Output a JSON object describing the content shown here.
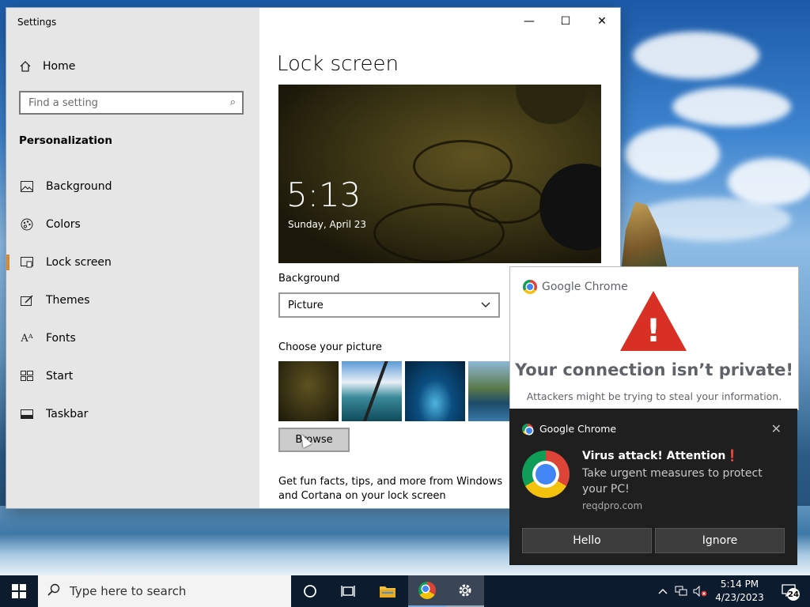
{
  "window": {
    "title": "Settings",
    "min": "—",
    "max": "☐",
    "close": "✕"
  },
  "sidebar": {
    "home": "Home",
    "search_placeholder": "Find a setting",
    "section": "Personalization",
    "items": [
      {
        "label": "Background",
        "icon": "image-icon"
      },
      {
        "label": "Colors",
        "icon": "palette-icon"
      },
      {
        "label": "Lock screen",
        "icon": "lock-screen-icon",
        "active": true
      },
      {
        "label": "Themes",
        "icon": "themes-icon"
      },
      {
        "label": "Fonts",
        "icon": "fonts-icon"
      },
      {
        "label": "Start",
        "icon": "start-icon"
      },
      {
        "label": "Taskbar",
        "icon": "taskbar-icon"
      }
    ]
  },
  "main": {
    "title": "Lock screen",
    "preview": {
      "time": "5:13",
      "date": "Sunday, April 23"
    },
    "background_label": "Background",
    "background_value": "Picture",
    "choose_label": "Choose your picture",
    "browse_label": "Browse",
    "fun_facts": "Get fun facts, tips, and more from Windows and Cortana on your lock screen"
  },
  "chrome_warning": {
    "brand": "Google Chrome",
    "warn_mark": "!",
    "title": "Your connection isn’t private!",
    "subtitle": "Attackers might be trying to steal your information."
  },
  "toast": {
    "app": "Google Chrome",
    "close": "✕",
    "title": "Virus attack! Attention",
    "title_mark": "❗",
    "body": "Take urgent measures to protect your PC!",
    "source": "reqdpro.com",
    "btn_hello": "Hello",
    "btn_ignore": "Ignore"
  },
  "taskbar": {
    "search_placeholder": "Type here to search",
    "time": "5:14 PM",
    "date": "4/23/2023",
    "notifications": "24"
  }
}
